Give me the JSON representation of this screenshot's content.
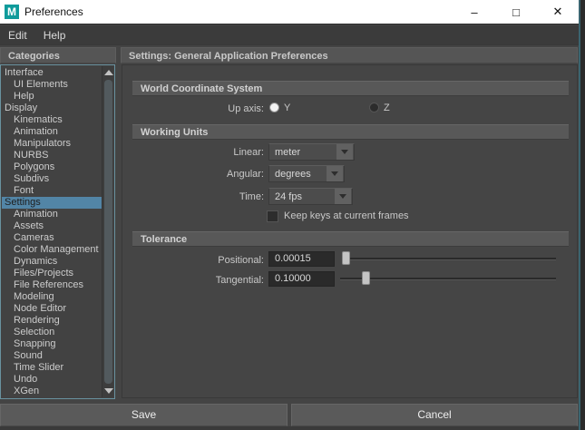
{
  "window": {
    "title": "Preferences",
    "controls": {
      "minimize": "–",
      "maximize": "□",
      "close": "✕"
    }
  },
  "menu": {
    "items": [
      "Edit",
      "Help"
    ]
  },
  "sidebar": {
    "header": "Categories",
    "items": [
      {
        "label": "Interface",
        "indent": 0,
        "selected": false
      },
      {
        "label": "UI Elements",
        "indent": 1,
        "selected": false
      },
      {
        "label": "Help",
        "indent": 1,
        "selected": false
      },
      {
        "label": "Display",
        "indent": 0,
        "selected": false
      },
      {
        "label": "Kinematics",
        "indent": 1,
        "selected": false
      },
      {
        "label": "Animation",
        "indent": 1,
        "selected": false
      },
      {
        "label": "Manipulators",
        "indent": 1,
        "selected": false
      },
      {
        "label": "NURBS",
        "indent": 1,
        "selected": false
      },
      {
        "label": "Polygons",
        "indent": 1,
        "selected": false
      },
      {
        "label": "Subdivs",
        "indent": 1,
        "selected": false
      },
      {
        "label": "Font",
        "indent": 1,
        "selected": false
      },
      {
        "label": "Settings",
        "indent": 0,
        "selected": true
      },
      {
        "label": "Animation",
        "indent": 1,
        "selected": false
      },
      {
        "label": "Assets",
        "indent": 1,
        "selected": false
      },
      {
        "label": "Cameras",
        "indent": 1,
        "selected": false
      },
      {
        "label": "Color Management",
        "indent": 1,
        "selected": false
      },
      {
        "label": "Dynamics",
        "indent": 1,
        "selected": false
      },
      {
        "label": "Files/Projects",
        "indent": 1,
        "selected": false
      },
      {
        "label": "File References",
        "indent": 1,
        "selected": false
      },
      {
        "label": "Modeling",
        "indent": 1,
        "selected": false
      },
      {
        "label": "Node Editor",
        "indent": 1,
        "selected": false
      },
      {
        "label": "Rendering",
        "indent": 1,
        "selected": false
      },
      {
        "label": "Selection",
        "indent": 1,
        "selected": false
      },
      {
        "label": "Snapping",
        "indent": 1,
        "selected": false
      },
      {
        "label": "Sound",
        "indent": 1,
        "selected": false
      },
      {
        "label": "Time Slider",
        "indent": 1,
        "selected": false
      },
      {
        "label": "Undo",
        "indent": 1,
        "selected": false
      },
      {
        "label": "XGen",
        "indent": 1,
        "selected": false
      }
    ]
  },
  "main": {
    "header": "Settings: General Application Preferences",
    "world_coordinate": {
      "title": "World Coordinate System",
      "up_axis_label": "Up axis:",
      "options": [
        {
          "label": "Y",
          "selected": true
        },
        {
          "label": "Z",
          "selected": false
        }
      ]
    },
    "working_units": {
      "title": "Working Units",
      "linear_label": "Linear:",
      "linear_value": "meter",
      "angular_label": "Angular:",
      "angular_value": "degrees",
      "time_label": "Time:",
      "time_value": "24 fps",
      "keep_keys_label": "Keep keys at current frames",
      "keep_keys_checked": false
    },
    "tolerance": {
      "title": "Tolerance",
      "positional_label": "Positional:",
      "positional_value": "0.00015",
      "tangential_label": "Tangential:",
      "tangential_value": "0.10000"
    }
  },
  "footer": {
    "save_label": "Save",
    "cancel_label": "Cancel"
  },
  "colors": {
    "selection_blue": "#5285a6",
    "panel_gray": "#454545",
    "header_gray": "#555555",
    "titlebar_white": "#ffffff",
    "focus_border_teal": "#69929f",
    "maya_icon_teal": "#0f9b9b"
  }
}
